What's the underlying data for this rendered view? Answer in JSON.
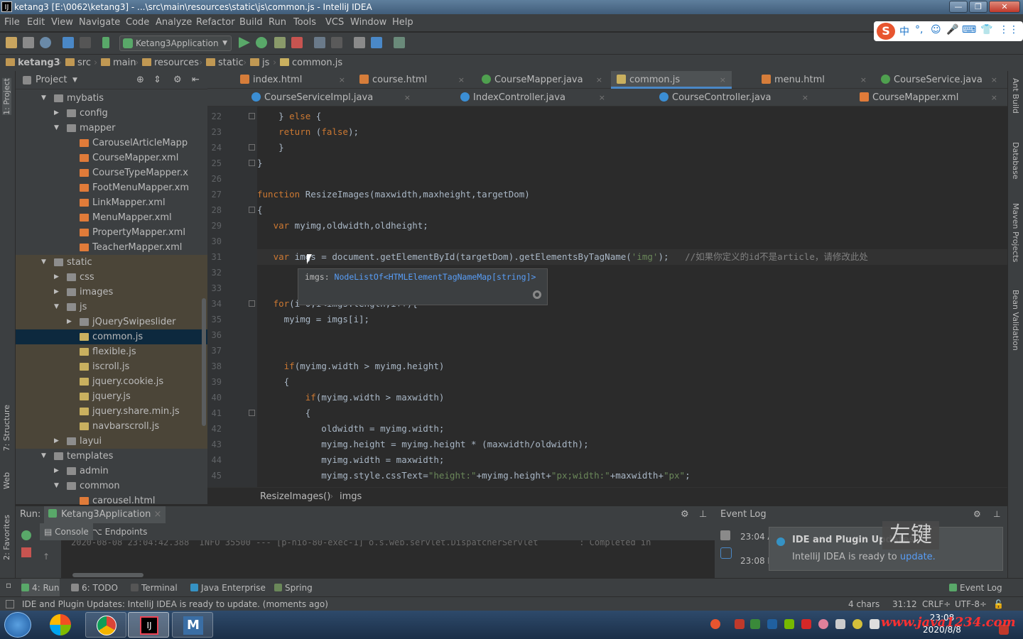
{
  "window": {
    "title": "ketang3 [E:\\0062\\ketang3] - ...\\src\\main\\resources\\static\\js\\common.js - IntelliJ IDEA",
    "app_icon": "IJ",
    "minimize": "—",
    "maximize": "❐",
    "close": "✕"
  },
  "menu": [
    "File",
    "Edit",
    "View",
    "Navigate",
    "Code",
    "Analyze",
    "Refactor",
    "Build",
    "Run",
    "Tools",
    "VCS",
    "Window",
    "Help"
  ],
  "ime_bar": {
    "logo": "S",
    "items": [
      "中",
      "°,",
      "☺",
      "🎤",
      "⌨",
      "👕",
      "⋮⋮"
    ]
  },
  "toolbar": {
    "run_config": "Ketang3Application"
  },
  "breadcrumb": [
    "ketang3",
    "src",
    "main",
    "resources",
    "static",
    "js",
    "common.js"
  ],
  "left_strip": {
    "project_tab": "1: Project",
    "structure_tab": "7: Structure",
    "web_tab": "Web",
    "favorites_tab": "2: Favorites"
  },
  "right_strip": {
    "ant": "Ant Build",
    "database": "Database",
    "maven": "Maven Projects",
    "bean": "Bean Validation"
  },
  "project_panel": {
    "title": "Project",
    "rows": [
      {
        "label": "mybatis",
        "type": "folder",
        "depth": 1,
        "arrow": "▼"
      },
      {
        "label": "config",
        "type": "folder",
        "depth": 2,
        "arrow": "▶"
      },
      {
        "label": "mapper",
        "type": "folder",
        "depth": 2,
        "arrow": "▼"
      },
      {
        "label": "CarouselArticleMapp",
        "type": "xml",
        "depth": 3,
        "arrow": ""
      },
      {
        "label": "CourseMapper.xml",
        "type": "xml",
        "depth": 3,
        "arrow": ""
      },
      {
        "label": "CourseTypeMapper.x",
        "type": "xml",
        "depth": 3,
        "arrow": ""
      },
      {
        "label": "FootMenuMapper.xm",
        "type": "xml",
        "depth": 3,
        "arrow": ""
      },
      {
        "label": "LinkMapper.xml",
        "type": "xml",
        "depth": 3,
        "arrow": ""
      },
      {
        "label": "MenuMapper.xml",
        "type": "xml",
        "depth": 3,
        "arrow": ""
      },
      {
        "label": "PropertyMapper.xml",
        "type": "xml",
        "depth": 3,
        "arrow": ""
      },
      {
        "label": "TeacherMapper.xml",
        "type": "xml",
        "depth": 3,
        "arrow": ""
      },
      {
        "label": "static",
        "type": "folder",
        "depth": 1,
        "arrow": "▼"
      },
      {
        "label": "css",
        "type": "folder",
        "depth": 2,
        "arrow": "▶"
      },
      {
        "label": "images",
        "type": "folder",
        "depth": 2,
        "arrow": "▶"
      },
      {
        "label": "js",
        "type": "folder",
        "depth": 2,
        "arrow": "▼"
      },
      {
        "label": "jQuerySwipeslider",
        "type": "folder",
        "depth": 3,
        "arrow": "▶"
      },
      {
        "label": "common.js",
        "type": "js",
        "depth": 3,
        "arrow": "",
        "selected": true
      },
      {
        "label": "flexible.js",
        "type": "js",
        "depth": 3,
        "arrow": ""
      },
      {
        "label": "iscroll.js",
        "type": "js",
        "depth": 3,
        "arrow": ""
      },
      {
        "label": "jquery.cookie.js",
        "type": "js",
        "depth": 3,
        "arrow": ""
      },
      {
        "label": "jquery.js",
        "type": "js",
        "depth": 3,
        "arrow": ""
      },
      {
        "label": "jquery.share.min.js",
        "type": "js",
        "depth": 3,
        "arrow": ""
      },
      {
        "label": "navbarscroll.js",
        "type": "js",
        "depth": 3,
        "arrow": ""
      },
      {
        "label": "layui",
        "type": "folder",
        "depth": 2,
        "arrow": "▶"
      },
      {
        "label": "templates",
        "type": "folder",
        "depth": 1,
        "arrow": "▼"
      },
      {
        "label": "admin",
        "type": "folder",
        "depth": 2,
        "arrow": "▶"
      },
      {
        "label": "common",
        "type": "folder",
        "depth": 2,
        "arrow": "▼"
      },
      {
        "label": "carousel.html",
        "type": "html",
        "depth": 3,
        "arrow": ""
      }
    ]
  },
  "editor_tabs_row1": [
    {
      "label": "index.html",
      "kind": "html"
    },
    {
      "label": "course.html",
      "kind": "html"
    },
    {
      "label": "CourseMapper.java",
      "kind": "java"
    },
    {
      "label": "common.js",
      "kind": "js",
      "active": true
    },
    {
      "label": "menu.html",
      "kind": "html"
    },
    {
      "label": "CourseService.java",
      "kind": "java"
    }
  ],
  "editor_tabs_row2": [
    {
      "label": "CourseServiceImpl.java",
      "kind": "c"
    },
    {
      "label": "IndexController.java",
      "kind": "c"
    },
    {
      "label": "CourseController.java",
      "kind": "c"
    },
    {
      "label": "CourseMapper.xml",
      "kind": "xml"
    }
  ],
  "editor": {
    "line_numbers": [
      "22",
      "23",
      "24",
      "25",
      "26",
      "27",
      "28",
      "29",
      "30",
      "31",
      "32",
      "33",
      "34",
      "35",
      "36",
      "37",
      "38",
      "39",
      "40",
      "41",
      "42",
      "43",
      "44",
      "45"
    ],
    "lines": [
      [
        {
          "t": "    } ",
          "c": ""
        },
        {
          "t": "else",
          "c": "kw"
        },
        {
          "t": " {",
          "c": ""
        }
      ],
      [
        {
          "t": "    ",
          "c": ""
        },
        {
          "t": "return",
          "c": "kw"
        },
        {
          "t": " (",
          "c": ""
        },
        {
          "t": "false",
          "c": "kw"
        },
        {
          "t": ");",
          "c": ""
        }
      ],
      [
        {
          "t": "    }",
          "c": ""
        }
      ],
      [
        {
          "t": "}",
          "c": ""
        }
      ],
      [],
      [
        {
          "t": "function",
          "c": "kw"
        },
        {
          "t": " ResizeImages(maxwidth,maxheight,targetDom)",
          "c": ""
        }
      ],
      [
        {
          "t": "{",
          "c": ""
        }
      ],
      [
        {
          "t": "   ",
          "c": ""
        },
        {
          "t": "var",
          "c": "kw"
        },
        {
          "t": " myimg,oldwidth,oldheight;",
          "c": ""
        }
      ],
      [],
      [
        {
          "t": "   ",
          "c": ""
        },
        {
          "t": "var",
          "c": "kw"
        },
        {
          "t": " imgs = document.getElementById(targetDom).getElementsByTagName(",
          "c": ""
        },
        {
          "t": "'img'",
          "c": "str"
        },
        {
          "t": ");   ",
          "c": ""
        },
        {
          "t": "//如果你定义的id不是article，请修改此处",
          "c": "cm"
        }
      ],
      [],
      [],
      [
        {
          "t": "   ",
          "c": ""
        },
        {
          "t": "for",
          "c": "kw"
        },
        {
          "t": "(i=0;i<imgs.length;i++){",
          "c": ""
        }
      ],
      [
        {
          "t": "     myimg = imgs[i];",
          "c": ""
        }
      ],
      [],
      [],
      [
        {
          "t": "     ",
          "c": ""
        },
        {
          "t": "if",
          "c": "kw"
        },
        {
          "t": "(myimg.width > myimg.height)",
          "c": ""
        }
      ],
      [
        {
          "t": "     {",
          "c": ""
        }
      ],
      [
        {
          "t": "         ",
          "c": ""
        },
        {
          "t": "if",
          "c": "kw"
        },
        {
          "t": "(myimg.width > maxwidth)",
          "c": ""
        }
      ],
      [
        {
          "t": "         {",
          "c": ""
        }
      ],
      [
        {
          "t": "            oldwidth = myimg.width;",
          "c": ""
        }
      ],
      [
        {
          "t": "            myimg.height = myimg.height * (maxwidth/oldwidth);",
          "c": ""
        }
      ],
      [
        {
          "t": "            myimg.width = maxwidth;",
          "c": ""
        }
      ],
      [
        {
          "t": "            myimg.style.cssText=",
          "c": ""
        },
        {
          "t": "\"height:\"",
          "c": "str"
        },
        {
          "t": "+myimg.height+",
          "c": ""
        },
        {
          "t": "\"px;width:\"",
          "c": "str"
        },
        {
          "t": "+maxwidth+",
          "c": ""
        },
        {
          "t": "\"px\"",
          "c": "str"
        },
        {
          "t": ";",
          "c": ""
        }
      ]
    ],
    "tooltip_name": "imgs: ",
    "tooltip_type": "NodeListOf<HTMLElementTagNameMap[string]>",
    "crumb": [
      "ResizeImages()",
      "imgs"
    ]
  },
  "run_panel": {
    "label": "Run:",
    "config": "Ketang3Application",
    "tabs": [
      "Console",
      "Endpoints"
    ],
    "console_line": "2020-08-08 23:04:42.388  INFO 35500 --- [p-nio-80-exec-1] o.s.web.servlet.DispatcherServlet        : Completed in"
  },
  "event_log": {
    "title": "Event Log",
    "times": [
      "23:04 A",
      "23:08 I"
    ],
    "notif_title": "IDE and Plugin Updates",
    "notif_body": "IntelliJ IDEA is ready to ",
    "notif_link": "update.",
    "overlay": "左键"
  },
  "bottom_tabs": [
    {
      "label": "4: Run",
      "color": "#59a869"
    },
    {
      "label": "6: TODO",
      "color": "#8a8a8a"
    },
    {
      "label": "Terminal",
      "color": "#555"
    },
    {
      "label": "Java Enterprise",
      "color": "#3592c4"
    },
    {
      "label": "Spring",
      "color": "#6a8759"
    }
  ],
  "bottom_right_tab": "Event Log",
  "status": {
    "message": "IDE and Plugin Updates: IntelliJ IDEA is ready to update. (moments ago)",
    "chars": "4 chars",
    "position": "31:12",
    "line_sep": "CRLF÷",
    "encoding": "UTF-8÷"
  },
  "taskbar": {
    "clock_time": "23:08",
    "clock_date": "2020/8/8",
    "watermark": "www.java1234.com"
  }
}
